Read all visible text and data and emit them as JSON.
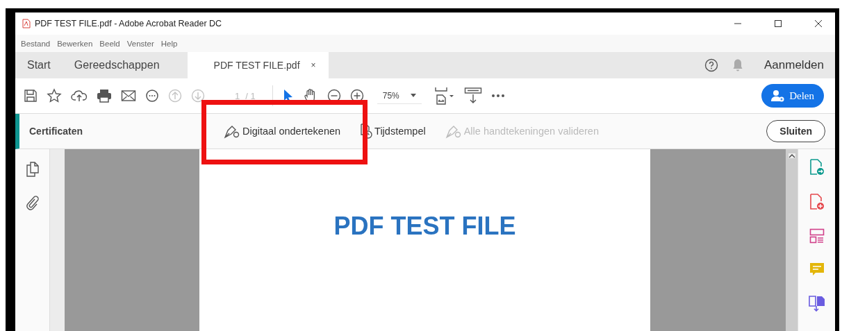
{
  "window": {
    "title": "PDF TEST FILE.pdf - Adobe Acrobat Reader DC"
  },
  "menu": [
    "Bestand",
    "Bewerken",
    "Beeld",
    "Venster",
    "Help"
  ],
  "tabs": [
    {
      "label": "Start",
      "selected": false
    },
    {
      "label": "Gereedschappen",
      "selected": false
    },
    {
      "label": "PDF TEST FILE.pdf",
      "selected": true,
      "close": "×"
    }
  ],
  "account": {
    "label": "Aanmelden"
  },
  "toolbar": {
    "icons": [
      {
        "kind": "save",
        "disabled": false
      },
      {
        "kind": "star",
        "disabled": false
      },
      {
        "kind": "upload",
        "disabled": false
      },
      {
        "kind": "print",
        "disabled": false
      },
      {
        "kind": "mail",
        "disabled": false
      },
      {
        "kind": "comment",
        "disabled": false
      },
      {
        "kind": "prev",
        "disabled": true
      },
      {
        "kind": "next",
        "disabled": true
      }
    ],
    "page_current": "1",
    "page_total": "/ 1",
    "zoom": "75%",
    "share": "Delen"
  },
  "tool_bar": {
    "title": "Certificaten",
    "actions": [
      {
        "label": "Digitaal ondertekenen",
        "kind": "sign",
        "disabled": false
      },
      {
        "label": "Tijdstempel",
        "kind": "timestamp",
        "disabled": false
      },
      {
        "label": "Alle handtekeningen valideren",
        "kind": "validate",
        "disabled": true
      }
    ],
    "close": "Sluiten"
  },
  "document": {
    "heading": "PDF TEST FILE"
  },
  "annotation": {
    "kind": "rectangle"
  }
}
